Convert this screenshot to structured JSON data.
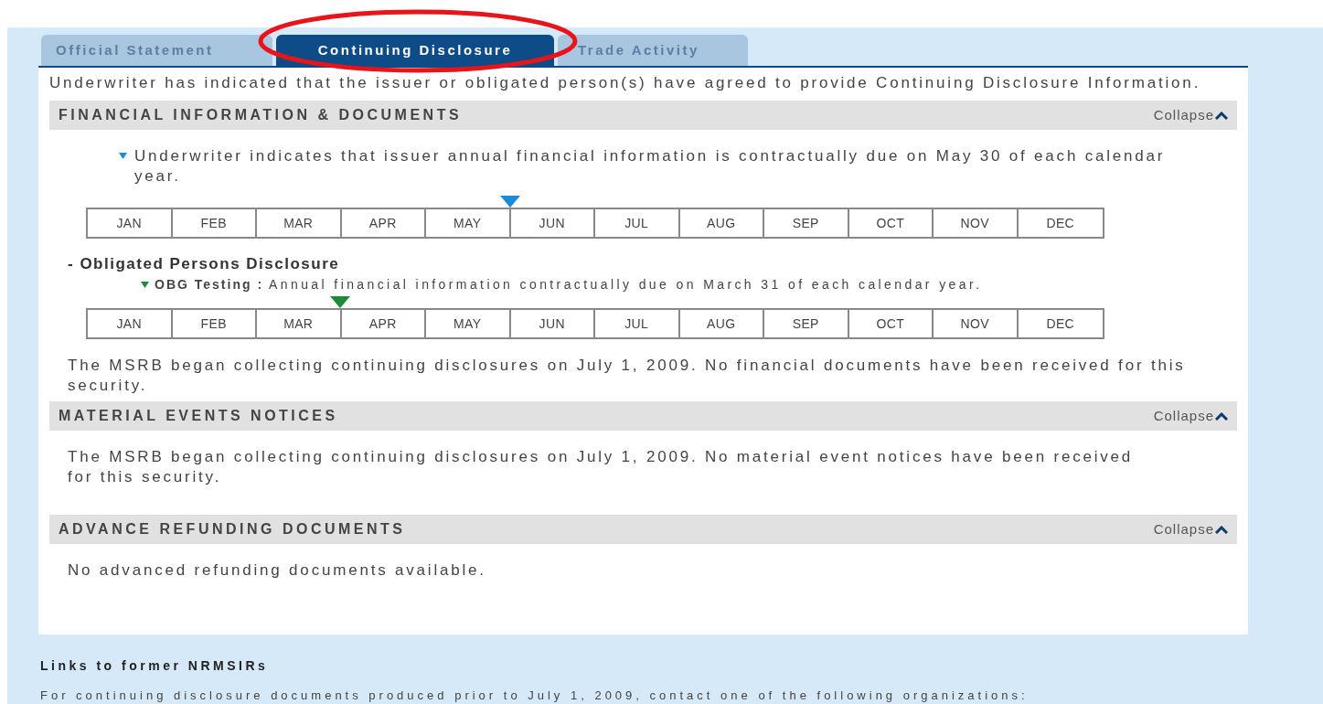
{
  "tabs": [
    {
      "label": "Official Statement",
      "selected": false
    },
    {
      "label": "Continuing Disclosure",
      "selected": true
    },
    {
      "label": "Trade Activity",
      "selected": false
    }
  ],
  "intro": "Underwriter has indicated that the issuer or obligated person(s) have agreed to provide Continuing Disclosure Information.",
  "sections": [
    {
      "kind": "financial",
      "title": "FINANCIAL INFORMATION & DOCUMENTS",
      "toggle": "Collapse",
      "expanded": true,
      "due_note": "Underwriter indicates that issuer annual financial information is contractually due on May 30 of each calendar year.",
      "calendar": {
        "color": "#1b8ad8",
        "months": [
          {
            "label": "JAN",
            "due": false
          },
          {
            "label": "FEB",
            "due": false
          },
          {
            "label": "MAR",
            "due": false
          },
          {
            "label": "APR",
            "due": false
          },
          {
            "label": "MAY",
            "due": true
          },
          {
            "label": "JUN",
            "due": false
          },
          {
            "label": "JUL",
            "due": false
          },
          {
            "label": "AUG",
            "due": false
          },
          {
            "label": "SEP",
            "due": false
          },
          {
            "label": "OCT",
            "due": false
          },
          {
            "label": "NOV",
            "due": false
          },
          {
            "label": "DEC",
            "due": false
          }
        ]
      },
      "obligated_heading": "- Obligated Persons Disclosure",
      "obligated": [
        {
          "name": "OBG Testing :",
          "note": "Annual financial information contractually due on March 31 of each calendar year.",
          "calendar": {
            "color": "#1f8a3a",
            "months": [
              {
                "label": "JAN",
                "due": false
              },
              {
                "label": "FEB",
                "due": false
              },
              {
                "label": "MAR",
                "due": true
              },
              {
                "label": "APR",
                "due": false
              },
              {
                "label": "MAY",
                "due": false
              },
              {
                "label": "JUN",
                "due": false
              },
              {
                "label": "JUL",
                "due": false
              },
              {
                "label": "AUG",
                "due": false
              },
              {
                "label": "SEP",
                "due": false
              },
              {
                "label": "OCT",
                "due": false
              },
              {
                "label": "NOV",
                "due": false
              },
              {
                "label": "DEC",
                "due": false
              }
            ]
          }
        }
      ],
      "body": "The MSRB began collecting continuing disclosures on July 1, 2009. No financial documents have been received for this security."
    },
    {
      "kind": "text",
      "title": "MATERIAL EVENTS NOTICES",
      "toggle": "Collapse",
      "expanded": true,
      "body": "The MSRB began collecting continuing disclosures on July 1, 2009. No material event notices have been received for this security."
    },
    {
      "kind": "text",
      "title": "ADVANCE REFUNDING DOCUMENTS",
      "toggle": "Collapse",
      "expanded": true,
      "body": "No advanced refunding documents available."
    }
  ],
  "links_heading": "Links to former NRMSIRs",
  "links_note": "For continuing disclosure documents produced prior to July 1, 2009, contact one of the following organizations:"
}
